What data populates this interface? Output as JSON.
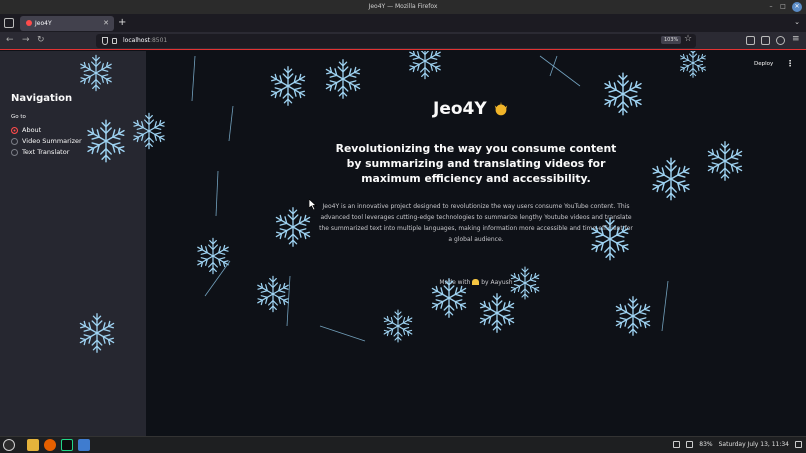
{
  "window": {
    "title": "Jeo4Y — Mozilla Firefox"
  },
  "tabs": [
    {
      "label": "Jeo4Y"
    }
  ],
  "navbar": {
    "url_host": "localhost",
    "url_port": ":8501",
    "zoom": "103%"
  },
  "sidebar": {
    "title": "Navigation",
    "goto_label": "Go to",
    "options": [
      {
        "label": "About",
        "selected": true
      },
      {
        "label": "Video Summarizer",
        "selected": false
      },
      {
        "label": "Text Translator",
        "selected": false
      }
    ]
  },
  "header": {
    "deploy_label": "Deploy",
    "menu_glyph": "⋮"
  },
  "main": {
    "title": "Jeo4Y",
    "subtitle": "Revolutionizing the way you consume content by summarizing and translating videos for maximum efficiency and accessibility.",
    "description": "Jeo4Y is an innovative project designed to revolutionize the way users consume YouTube content. This advanced tool leverages cutting-edge technologies to summarize lengthy Youtube videos and translate the summarized text into multiple languages, making information more accessible and time-efficient for a global audience.",
    "made_with_prefix": "Made with",
    "made_with_suffix": "by Aayush"
  },
  "taskbar": {
    "battery": "83%",
    "datetime": "Saturday July 13, 11:34"
  },
  "colors": {
    "accent": "#ff4b4b",
    "sidebar_bg": "#262730",
    "main_bg": "#0e1117",
    "snow": "#9fd3f2"
  }
}
